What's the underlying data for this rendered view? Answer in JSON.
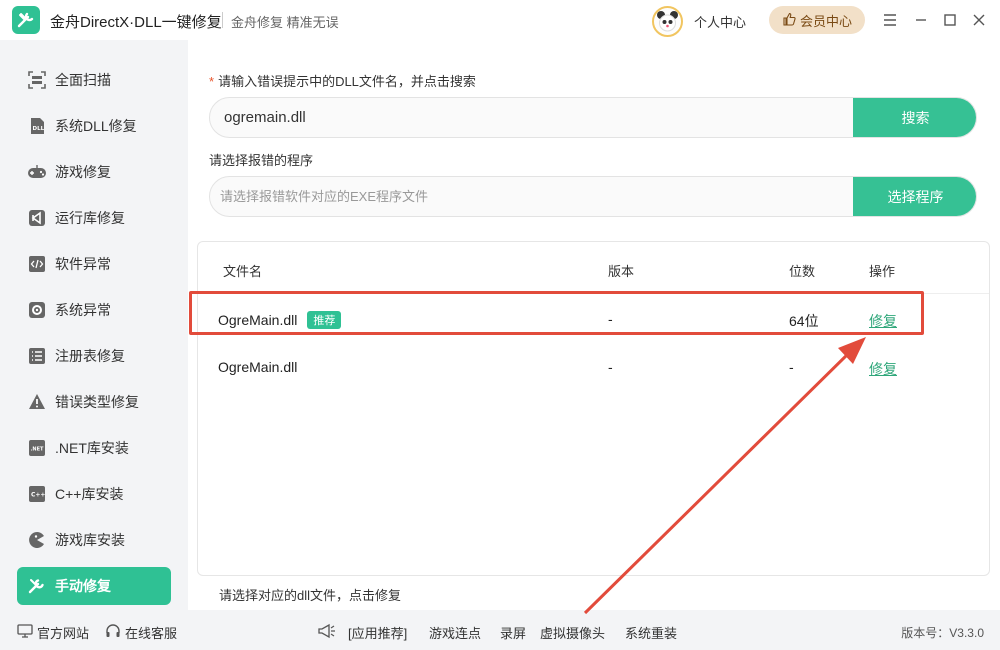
{
  "titlebar": {
    "app_title": "金舟DirectX·DLL一键修复",
    "slogan": "金舟修复 精准无误",
    "user_center": "个人中心",
    "vip_center": "会员中心"
  },
  "sidebar": {
    "items": [
      {
        "label": "全面扫描",
        "icon": "scan-icon"
      },
      {
        "label": "系统DLL修复",
        "icon": "dll-icon"
      },
      {
        "label": "游戏修复",
        "icon": "gamepad-icon"
      },
      {
        "label": "运行库修复",
        "icon": "vs-icon"
      },
      {
        "label": "软件异常",
        "icon": "code-icon"
      },
      {
        "label": "系统异常",
        "icon": "gear-icon"
      },
      {
        "label": "注册表修复",
        "icon": "list-icon"
      },
      {
        "label": "错误类型修复",
        "icon": "warning-icon"
      },
      {
        "label": ".NET库安装",
        "icon": "dotnet-icon"
      },
      {
        "label": "C++库安装",
        "icon": "cpp-icon"
      },
      {
        "label": "游戏库安装",
        "icon": "pacman-icon"
      },
      {
        "label": "手动修复",
        "icon": "wrench-icon",
        "active": true
      }
    ]
  },
  "main": {
    "dll_label_star": "*",
    "dll_label": "请输入错误提示中的DLL文件名，并点击搜索",
    "search_value": "ogremain.dll",
    "search_button": "搜索",
    "program_label": "请选择报错的程序",
    "program_placeholder": "请选择报错软件对应的EXE程序文件",
    "program_button": "选择程序",
    "table": {
      "headers": {
        "name": "文件名",
        "version": "版本",
        "bits": "位数",
        "action": "操作"
      },
      "rows": [
        {
          "name": "OgreMain.dll",
          "badge": "推荐",
          "version": "-",
          "bits": "64位",
          "action": "修复"
        },
        {
          "name": "OgreMain.dll",
          "badge": "",
          "version": "-",
          "bits": "-",
          "action": "修复"
        }
      ]
    },
    "hint": "请选择对应的dll文件，点击修复"
  },
  "footer": {
    "official_site": "官方网站",
    "online_service": "在线客服",
    "links": [
      "[应用推荐]",
      "游戏连点",
      "录屏",
      "虚拟摄像头",
      "系统重装"
    ],
    "version": "版本号：V3.3.0"
  },
  "colors": {
    "accent": "#2fc194",
    "annotation_red": "#e24b3b"
  }
}
